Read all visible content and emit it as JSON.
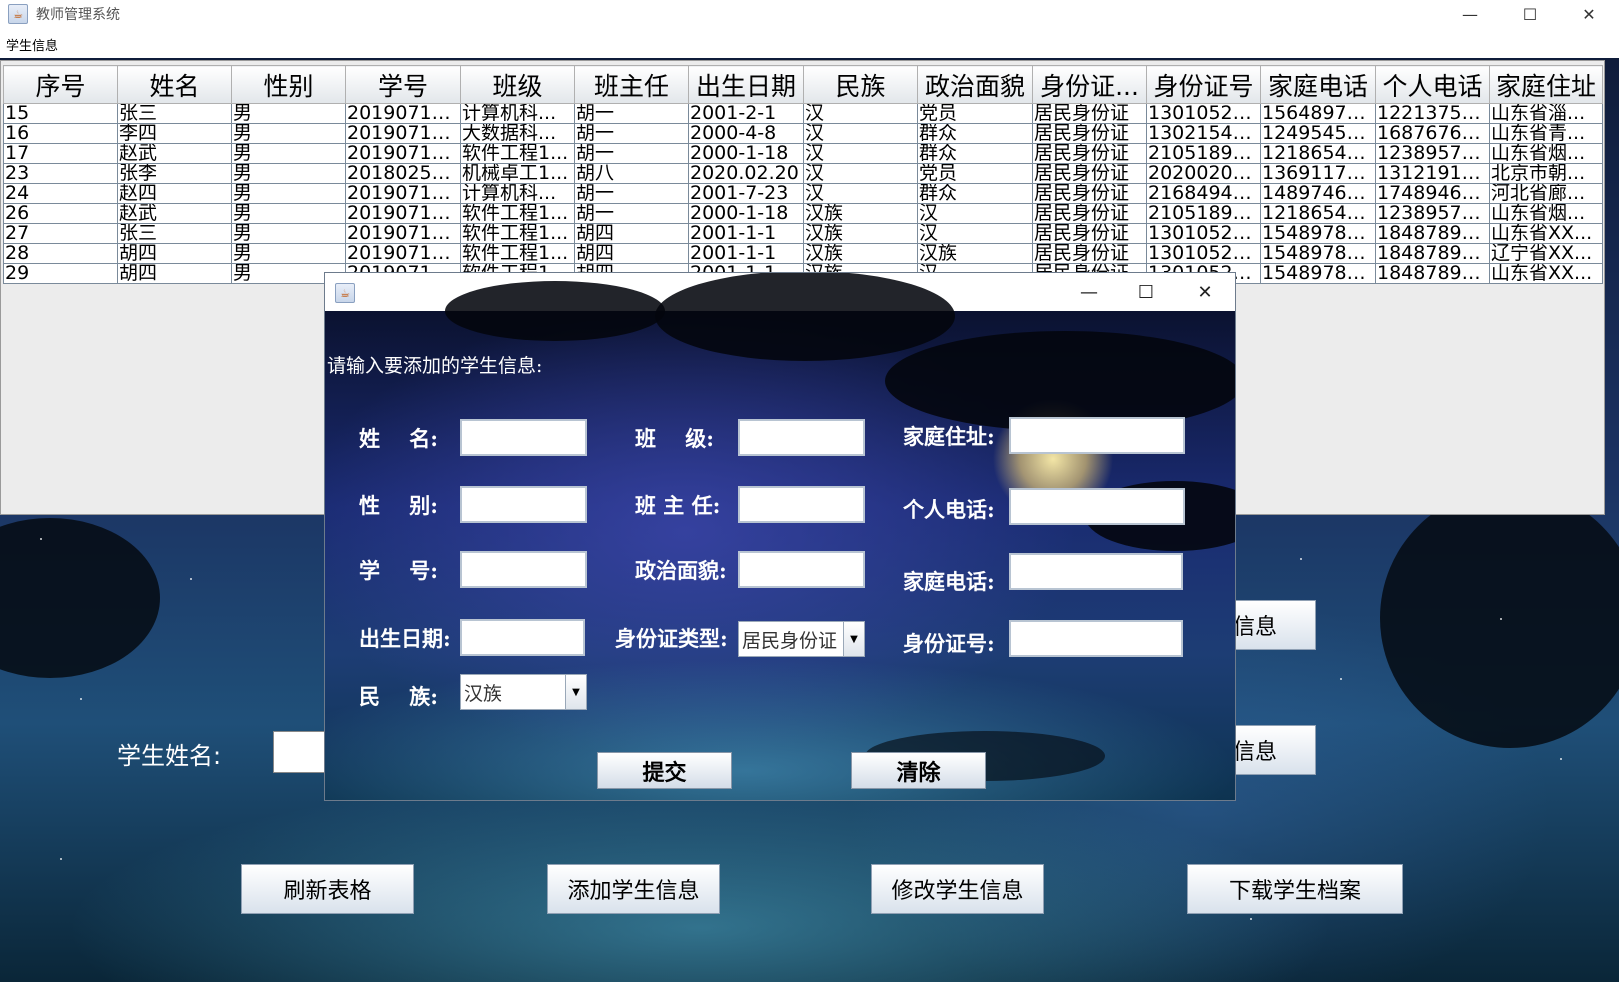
{
  "window": {
    "title": "教师管理系统",
    "controls": {
      "minimize": "—",
      "maximize": "☐",
      "close": "✕"
    }
  },
  "menu": {
    "item": "学生信息"
  },
  "table": {
    "columns": [
      "序号",
      "姓名",
      "性别",
      "学号",
      "班级",
      "班主任",
      "出生日期",
      "民族",
      "政治面貌",
      "身份证...",
      "身份证号",
      "家庭电话",
      "个人电话",
      "家庭住址"
    ],
    "rows": [
      [
        "15",
        "张三",
        "男",
        "20190713...",
        "计算机科...",
        "胡一",
        "2001-2-1",
        "汉",
        "党员",
        "居民身份证",
        "13010520...",
        "15648978...",
        "12213753...",
        "山东省淄..."
      ],
      [
        "16",
        "李四",
        "男",
        "20190713...",
        "大数据科...",
        "胡一",
        "2000-4-8",
        "汉",
        "群众",
        "居民身份证",
        "13021548...",
        "12495458...",
        "16876767...",
        "山东省青..."
      ],
      [
        "17",
        "赵武",
        "男",
        "20190713...",
        "软件工程1...",
        "胡一",
        "2000-1-18",
        "汉",
        "群众",
        "居民身份证",
        "21051897...",
        "12186548...",
        "12389576...",
        "山东省烟..."
      ],
      [
        "23",
        "张李",
        "男",
        "20180251...",
        "机械卓工1...",
        "胡八",
        "2020.02.20",
        "汉",
        "党员",
        "居民身份证",
        "20200202...",
        "13691177...",
        "13121918...",
        "北京市朝..."
      ],
      [
        "24",
        "赵四",
        "男",
        "20190713...",
        "计算机科...",
        "胡一",
        "2001-7-23",
        "汉",
        "群众",
        "居民身份证",
        "21684941...",
        "14897461...",
        "17489465...",
        "河北省廊..."
      ],
      [
        "26",
        "赵武",
        "男",
        "20190713...",
        "软件工程1...",
        "胡一",
        "2000-1-18",
        "汉族",
        "汉",
        "居民身份证",
        "21051897...",
        "12186548...",
        "12389576...",
        "山东省烟..."
      ],
      [
        "27",
        "张三",
        "男",
        "20190713...",
        "软件工程1...",
        "胡四",
        "2001-1-1",
        "汉族",
        "汉",
        "居民身份证",
        "13010520...",
        "15489789...",
        "18487897...",
        "山东省XX..."
      ],
      [
        "28",
        "胡四",
        "男",
        "20190713...",
        "软件工程1...",
        "胡四",
        "2001-1-1",
        "汉族",
        "汉族",
        "居民身份证",
        "13010520...",
        "15489789...",
        "18487897...",
        "辽宁省XX..."
      ],
      [
        "29",
        "胡四",
        "男",
        "20190713...",
        "软件工程1...",
        "胡四",
        "2001-1-1",
        "汉族",
        "汉",
        "居民身份证",
        "13010520...",
        "15489789...",
        "18487897...",
        "山东省XX..."
      ]
    ]
  },
  "main": {
    "student_name_label": "学生姓名:",
    "side_btn_1": "生信息",
    "side_btn_2": "生信息",
    "buttons": {
      "refresh": "刷新表格",
      "add": "添加学生信息",
      "edit": "修改学生信息",
      "download": "下载学生档案"
    }
  },
  "dialog": {
    "controls": {
      "minimize": "—",
      "maximize": "☐",
      "close": "✕"
    },
    "prompt": "请输入要添加的学生信息:",
    "labels": {
      "name": "姓    名:",
      "class": "班    级:",
      "address": "家庭住址:",
      "gender": "性    别:",
      "teacher": "班 主 任:",
      "personal_phone": "个人电话:",
      "student_id": "学    号:",
      "politics": "政治面貌:",
      "home_phone": "家庭电话:",
      "birth": "出生日期:",
      "id_type": "身份证类型:",
      "id_number": "身份证号:",
      "ethnicity": "民    族:"
    },
    "id_type_value": "居民身份证",
    "ethnicity_value": "汉族",
    "submit": "提交",
    "clear": "清除"
  }
}
